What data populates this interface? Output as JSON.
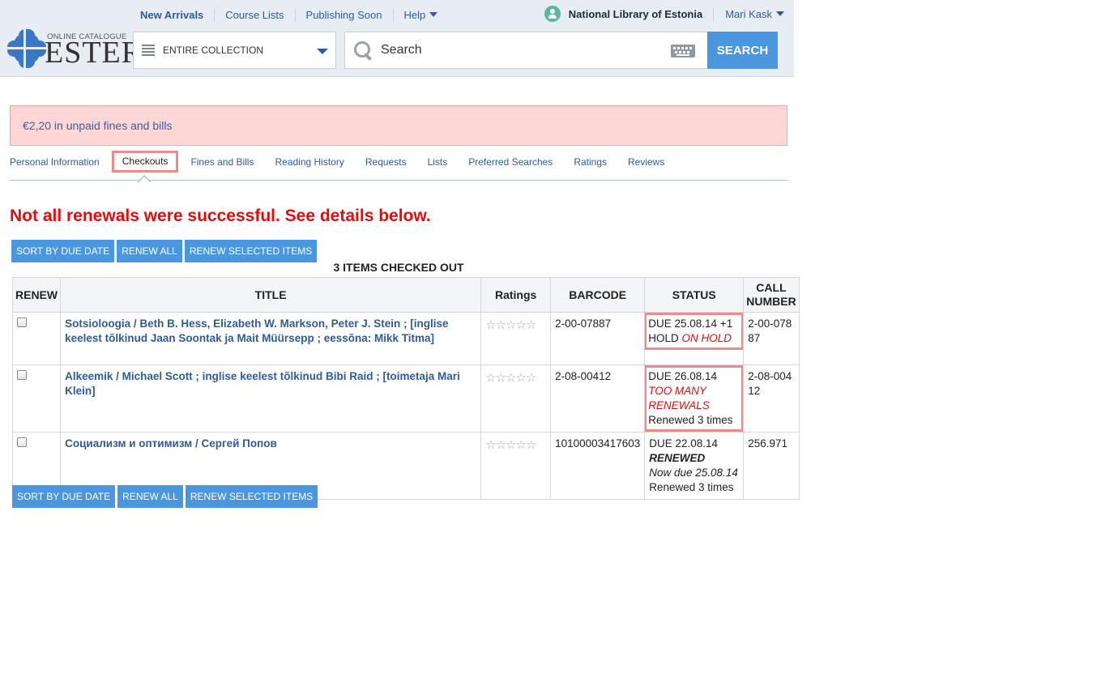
{
  "topnav": {
    "items": [
      {
        "label": "New Arrivals"
      },
      {
        "label": "Course Lists"
      },
      {
        "label": "Publishing Soon"
      },
      {
        "label": "Help"
      }
    ],
    "library": "National Library of Estonia",
    "user": "Mari Kask"
  },
  "logo": {
    "small": "ONLINE CATALOGUE",
    "big": "ESTER"
  },
  "search": {
    "scope": "ENTIRE COLLECTION",
    "placeholder": "Search",
    "button": "SEARCH"
  },
  "alert": "€2,20 in unpaid fines and bills",
  "tabs": [
    {
      "label": "Personal Information"
    },
    {
      "label": "Checkouts"
    },
    {
      "label": "Fines and Bills"
    },
    {
      "label": "Reading History"
    },
    {
      "label": "Requests"
    },
    {
      "label": "Lists"
    },
    {
      "label": "Preferred Searches"
    },
    {
      "label": "Ratings"
    },
    {
      "label": "Reviews"
    }
  ],
  "error": "Not all renewals were successful. See details below.",
  "actions": {
    "sort": "SORT BY DUE DATE",
    "renew_all": "RENEW ALL",
    "renew_selected": "RENEW SELECTED ITEMS"
  },
  "count": "3 ITEMS CHECKED OUT",
  "table": {
    "headers": [
      "RENEW",
      "TITLE",
      "Ratings",
      "BARCODE",
      "STATUS",
      "CALL NUMBER"
    ],
    "rows": [
      {
        "title": "Sotsioloogia / Beth B. Hess, Elizabeth W. Markson, Peter J. Stein ; [inglise keelest tõlkinud Jaan Soontak ja Mait Müürsepp ; eessõna: Mikk Titma]",
        "barcode": "2-00-07887",
        "status_due": "DUE 25.08.14 +1 HOLD",
        "status_flag": "ON HOLD",
        "status_extra": "",
        "call": "2-00-07887"
      },
      {
        "title": "Alkeemik / Michael Scott ; inglise keelest tõlkinud Bibi Raid ; [toimetaja Mari Klein]",
        "barcode": "2-08-00412",
        "status_due": "DUE 26.08.14",
        "status_flag": "TOO MANY RENEWALS",
        "status_extra": "Renewed 3 times",
        "call": "2-08-00412"
      },
      {
        "title": "Социализм и оптимизм / Сергей Попов",
        "barcode": "10100003417603",
        "status_due": "DUE 22.08.14",
        "status_flag": "RENEWED",
        "status_now": "Now due 25.08.14",
        "status_extra": "Renewed 3 times",
        "call": "256.971"
      }
    ]
  },
  "icons": {
    "user": "user-circle-icon",
    "list": "list-icon",
    "search": "search-icon",
    "keyboard": "keyboard-icon",
    "stars": "rating-star-icon"
  },
  "colors": {
    "accent": "#4a97e0",
    "link": "#2f5c99",
    "error": "#e10c0c",
    "alert_bg": "#fdd6d6",
    "highlight": "#ef8a8a"
  }
}
